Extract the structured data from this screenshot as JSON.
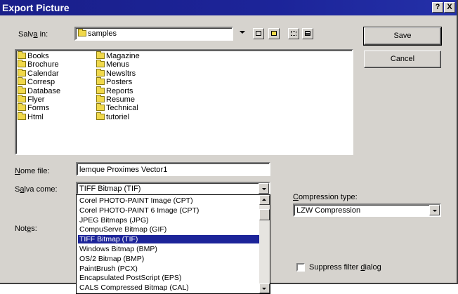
{
  "window": {
    "title": "Export Picture",
    "help_glyph": "?",
    "close_glyph": "X"
  },
  "save_in": {
    "label_pre": "Salv",
    "label_ul": "a",
    "label_post": " in:",
    "value": "samples"
  },
  "buttons": {
    "save": "Save",
    "cancel": "Cancel"
  },
  "folders_col1": [
    "Books",
    "Brochure",
    "Calendar",
    "Corresp",
    "Database",
    "Flyer",
    "Forms",
    "Html"
  ],
  "folders_col2": [
    "Magazine",
    "Menus",
    "Newsltrs",
    "Posters",
    "Reports",
    "Resume",
    "Technical",
    "tutoriel"
  ],
  "file_name": {
    "label_pre": "",
    "label_ul": "N",
    "label_post": "ome file:",
    "value": "lemque Proximes Vector1"
  },
  "save_as": {
    "label_pre": "S",
    "label_ul": "a",
    "label_post": "lva come:",
    "value": "TIFF Bitmap (TIF)"
  },
  "notes": {
    "label_pre": "Not",
    "label_ul": "e",
    "label_post": "s:"
  },
  "compression": {
    "label_pre": "",
    "label_ul": "C",
    "label_post": "ompression type:",
    "value": "LZW Compression"
  },
  "suppress": {
    "label_pre": "Suppress filter ",
    "label_ul": "d",
    "label_post": "ialog"
  },
  "format_options": [
    "Corel PHOTO-PAINT Image (CPT)",
    "Corel PHOTO-PAINT 6 Image (CPT)",
    "JPEG Bitmaps (JPG)",
    "CompuServe Bitmap (GIF)",
    "TIFF Bitmap (TIF)",
    "Windows Bitmap (BMP)",
    "OS/2 Bitmap (BMP)",
    "PaintBrush (PCX)",
    "Encapsulated PostScript (EPS)",
    "CALS Compressed Bitmap (CAL)"
  ],
  "selected_format_index": 4,
  "icons": {
    "folder": "folder-icon",
    "up_folder": "up-one-level-icon",
    "new_folder": "new-folder-icon",
    "list_view": "list-view-icon",
    "details_view": "details-view-icon"
  }
}
